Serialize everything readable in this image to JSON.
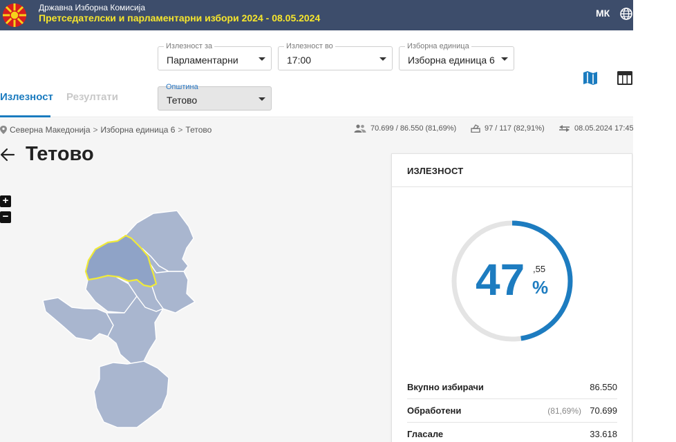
{
  "header": {
    "org": "Државна Изборна Комисија",
    "election_title": "Претседателски и парламентарни избори 2024 - 08.05.2024",
    "language": "МК"
  },
  "filters": {
    "turnout_for": {
      "label": "Излезност за",
      "value": "Парламентарни"
    },
    "turnout_at": {
      "label": "Излезност во",
      "value": "17:00"
    },
    "electoral_unit": {
      "label": "Изборна единица",
      "value": "Изборна единица 6"
    },
    "municipality": {
      "label": "Општина",
      "value": "Тетово"
    }
  },
  "tabs": [
    {
      "label": "Излезност",
      "active": true
    },
    {
      "label": "Резултати",
      "active": false
    }
  ],
  "breadcrumb": [
    "Северна Македонија",
    "Изборна единица 6",
    "Тетово"
  ],
  "stats": {
    "voters": "70.699 / 86.550 (81,69%)",
    "polling_stations": "97 / 117 (82,91%)",
    "updated": "08.05.2024 17:45"
  },
  "place_title": "Тетово",
  "zoom": {
    "in": "+",
    "out": "−"
  },
  "turnout_card": {
    "title": "ИЗЛЕЗНОСТ",
    "percent_int": "47",
    "percent_dec": ",55",
    "percent_sign": "%",
    "percent_value": 47.55,
    "rows": [
      {
        "label": "Вкупно избирачи",
        "value": "86.550",
        "pct": ""
      },
      {
        "label": "Обработени",
        "value": "70.699",
        "pct": "(81,69%)"
      },
      {
        "label": "Гласале",
        "value": "33.618",
        "pct": ""
      }
    ]
  },
  "colors": {
    "header_bg": "#3d4d6b",
    "title_yellow": "#f7e62c",
    "accent_blue": "#1d7cc0",
    "map_fill": "#a9b6cf",
    "map_selected_fill": "#8fa3c7",
    "map_highlight": "#f0ea3a"
  },
  "icons": {
    "logo": "mk-flag-logo",
    "globe": "globe-icon",
    "map_view": "map-icon",
    "table_view": "table-icon",
    "breadcrumb": "location-pin-icon",
    "voters": "people-icon",
    "stations": "ballot-box-icon",
    "updated": "sync-arrows-icon",
    "back": "arrow-left-icon"
  }
}
